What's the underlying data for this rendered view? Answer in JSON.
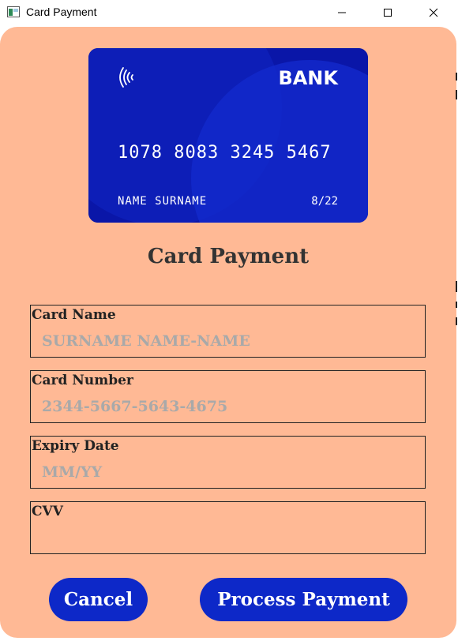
{
  "window": {
    "title": "Card Payment",
    "icon": "app-window-icon",
    "controls": [
      "minimize-icon",
      "maximize-icon",
      "close-icon"
    ]
  },
  "card": {
    "bank": "BANK",
    "number": "1078 8083 3245 5467",
    "holder": "NAME SURNAME",
    "expiry": "8/22",
    "contactless_icon": "contactless-icon"
  },
  "heading": "Card Payment",
  "form": {
    "card_name": {
      "label": "Card Name",
      "placeholder": "SURNAME NAME-NAME",
      "value": ""
    },
    "card_number": {
      "label": "Card Number",
      "placeholder": "2344-5667-5643-4675",
      "value": ""
    },
    "expiry_date": {
      "label": "Expiry Date",
      "placeholder": "MM/YY",
      "value": ""
    },
    "cvv": {
      "label": "CVV",
      "placeholder": "",
      "value": ""
    }
  },
  "buttons": {
    "cancel": "Cancel",
    "process": "Process Payment"
  },
  "colors": {
    "panel_background": "#ffb995",
    "accent_blue": "#0d28c8",
    "card_blue": "#0a16a8",
    "text_dark": "#333333",
    "placeholder": "#a9a9a9"
  }
}
